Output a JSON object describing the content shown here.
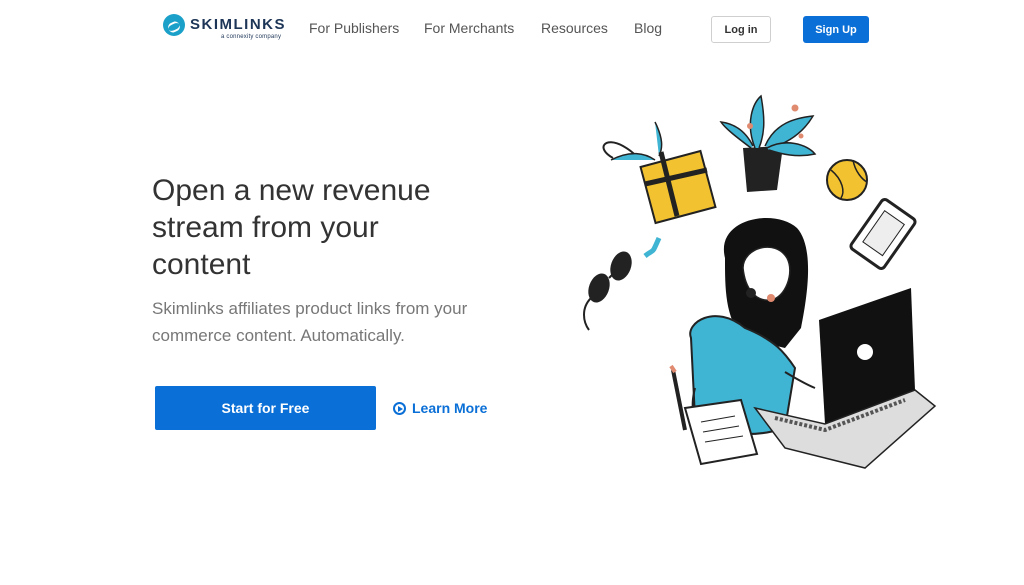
{
  "brand": {
    "name": "SKIMLINKS",
    "tagline": "a connexity company",
    "color": "#1ba1c9"
  },
  "nav": {
    "items": [
      "For Publishers",
      "For Merchants",
      "Resources",
      "Blog"
    ],
    "login_label": "Log in",
    "signup_label": "Sign Up"
  },
  "hero": {
    "title": "Open a new revenue stream from your content",
    "subtitle": "Skimlinks affiliates product links from your commerce content. Automatically.",
    "primary_cta": "Start for Free",
    "secondary_cta": "Learn More"
  },
  "colors": {
    "accent": "#0a6fd6",
    "teal": "#3fb4d3",
    "yellow": "#f2c230"
  },
  "icons": {
    "play": "play-circle-icon"
  }
}
